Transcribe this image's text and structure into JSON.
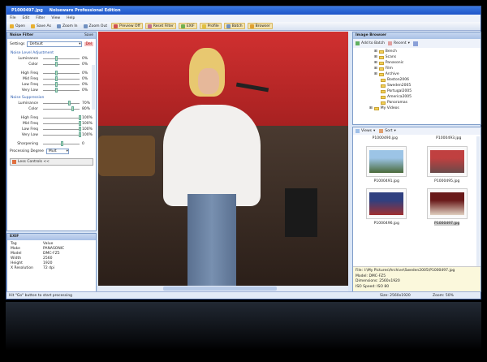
{
  "window": {
    "title": "P1000497.jpg",
    "app_name": "Noiseware Professional Edition"
  },
  "menu": [
    "File",
    "Edit",
    "Filter",
    "View",
    "Help"
  ],
  "toolbar": [
    {
      "label": "Open",
      "icon": "open-icon",
      "color": "#e8b030"
    },
    {
      "label": "Save As",
      "icon": "save-icon",
      "color": "#e8b030"
    },
    {
      "label": "Zoom In",
      "icon": "zoom-in-icon",
      "color": "#7090c0"
    },
    {
      "label": "Zoom Out",
      "icon": "zoom-out-icon",
      "color": "#7090c0"
    },
    {
      "label": "Preview Off",
      "icon": "preview-icon",
      "color": "#d05050",
      "highlight": true
    },
    {
      "label": "Reset Filter",
      "icon": "reset-icon",
      "color": "#c07090",
      "highlight": true
    },
    {
      "label": "EXIF",
      "icon": "exif-icon",
      "color": "#70b050",
      "highlight": true
    },
    {
      "label": "Profile",
      "icon": "profile-icon",
      "color": "#e0c040",
      "highlight": true
    },
    {
      "label": "Batch",
      "icon": "batch-icon",
      "color": "#7090c0",
      "highlight": true
    },
    {
      "label": "Browser",
      "icon": "browser-icon",
      "color": "#e0a030",
      "highlight": true
    }
  ],
  "noise_filter": {
    "title": "Noise Filter",
    "save_label": "Save",
    "settings_label": "Settings",
    "settings_value": "Default",
    "delete_label": "Del",
    "level_section": "Noise Level Adjustment",
    "level": [
      {
        "label": "Luminance",
        "value": "0%",
        "pos": 0.35
      },
      {
        "label": "Color",
        "value": "0%",
        "pos": 0.35
      }
    ],
    "level_freq": [
      {
        "label": "High Freq",
        "value": "0%",
        "pos": 0.35
      },
      {
        "label": "Mid Freq",
        "value": "0%",
        "pos": 0.35
      },
      {
        "label": "Low Freq",
        "value": "0%",
        "pos": 0.35
      },
      {
        "label": "Very Low",
        "value": "0%",
        "pos": 0.35
      }
    ],
    "supp_section": "Noise Suppression",
    "supp": [
      {
        "label": "Luminance",
        "value": "70%",
        "pos": 0.7
      },
      {
        "label": "Color",
        "value": "80%",
        "pos": 0.8
      }
    ],
    "supp_freq": [
      {
        "label": "High Freq",
        "value": "100%",
        "pos": 1
      },
      {
        "label": "Mid Freq",
        "value": "100%",
        "pos": 1
      },
      {
        "label": "Low Freq",
        "value": "100%",
        "pos": 1
      },
      {
        "label": "Very Low",
        "value": "100%",
        "pos": 1
      }
    ],
    "sharpening": {
      "label": "Sharpening",
      "value": "0",
      "pos": 0.5
    },
    "processing_label": "Processing Degree",
    "processing_value": "Mult",
    "less_controls": "Less Controls <<"
  },
  "exif": {
    "title": "EXIF",
    "header": [
      "Tag",
      "Value"
    ],
    "rows": [
      [
        "Make",
        "PANASONIC"
      ],
      [
        "Model",
        "DMC-FZ5"
      ],
      [
        "Width",
        "2560"
      ],
      [
        "Height",
        "1920"
      ],
      [
        "X Resolution",
        "72 dpi"
      ]
    ]
  },
  "browser": {
    "title": "Image Browser",
    "add_batch": "Add to Batch",
    "recent": "Recent",
    "folders": [
      {
        "name": "Bench",
        "level": 1
      },
      {
        "name": "Scans",
        "level": 1
      },
      {
        "name": "Panasonic",
        "level": 1
      },
      {
        "name": "Film",
        "level": 1
      },
      {
        "name": "Archive",
        "level": 1
      },
      {
        "name": "Boston2006",
        "level": 2
      },
      {
        "name": "Sweden2005",
        "level": 2
      },
      {
        "name": "Portugal2005",
        "level": 2
      },
      {
        "name": "America2005",
        "level": 2
      },
      {
        "name": "Panoramas",
        "level": 2
      },
      {
        "name": "My Videos",
        "level": 0
      }
    ],
    "views": "Views",
    "sort": "Sort",
    "thumbs_top": [
      "P1000490.jpg",
      "P1000493.jpg"
    ],
    "thumbs": [
      {
        "name": "P1000491.jpg",
        "colors": [
          "#9cc4e6",
          "#4a6a3a"
        ]
      },
      {
        "name": "P1000495.jpg",
        "colors": [
          "#c04040",
          "#6a4a4a"
        ]
      },
      {
        "name": "P1000496.jpg",
        "colors": [
          "#304080",
          "#a03030"
        ]
      },
      {
        "name": "P1000497.jpg",
        "colors": [
          "#6a1a1a",
          "#e0d0c0"
        ],
        "selected": true
      }
    ],
    "info": [
      "File: I:\\My Pictures\\Archive\\Sweden2005\\P1000497.jpg",
      "Model: DMC-FZ5",
      "Dimensions: 2560x1920",
      "ISO Speed: ISO 80"
    ]
  },
  "status": {
    "message": "Hit \"Go\" button to start processing",
    "size": "Size: 2560x1920",
    "zoom": "Zoom: 50%"
  }
}
